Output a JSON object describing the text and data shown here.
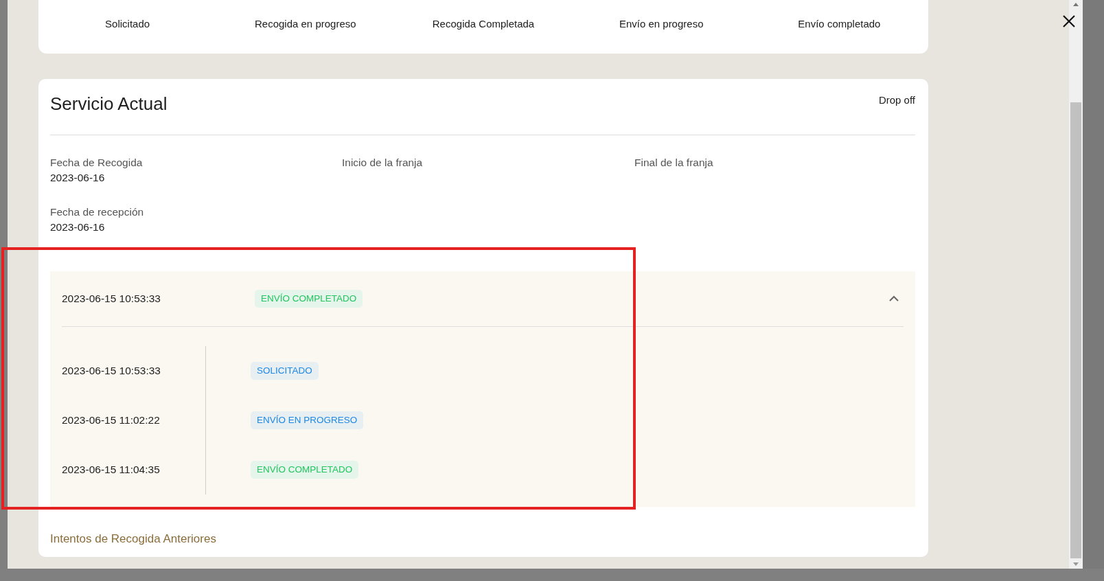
{
  "steps": [
    {
      "label": "Solicitado"
    },
    {
      "label": "Recogida en progreso"
    },
    {
      "label": "Recogida Completada"
    },
    {
      "label": "Envío en progreso"
    },
    {
      "label": "Envío completado"
    }
  ],
  "service": {
    "title": "Servicio Actual",
    "type": "Drop off",
    "fields": [
      {
        "label": "Fecha de Recogida",
        "value": "2023-06-16"
      },
      {
        "label": "Inicio de la franja"
      },
      {
        "label": "Final de la franja"
      },
      {
        "label": "Fecha de recepción",
        "value": "2023-06-16"
      }
    ]
  },
  "history": {
    "expanded": true,
    "date": "2023-06-15 10:53:33",
    "status": {
      "text": "ENVÍO COMPLETADO",
      "kind": "success"
    },
    "events": [
      {
        "date": "2023-06-15 10:53:33",
        "status": {
          "text": "SOLICITADO",
          "kind": "info"
        }
      },
      {
        "date": "2023-06-15 11:02:22",
        "status": {
          "text": "ENVÍO EN PROGRESO",
          "kind": "info"
        }
      },
      {
        "date": "2023-06-15 11:04:35",
        "status": {
          "text": "ENVÍO COMPLETADO",
          "kind": "success"
        }
      }
    ]
  },
  "previous_attempts_link": "Intentos de Recogida Anteriores"
}
